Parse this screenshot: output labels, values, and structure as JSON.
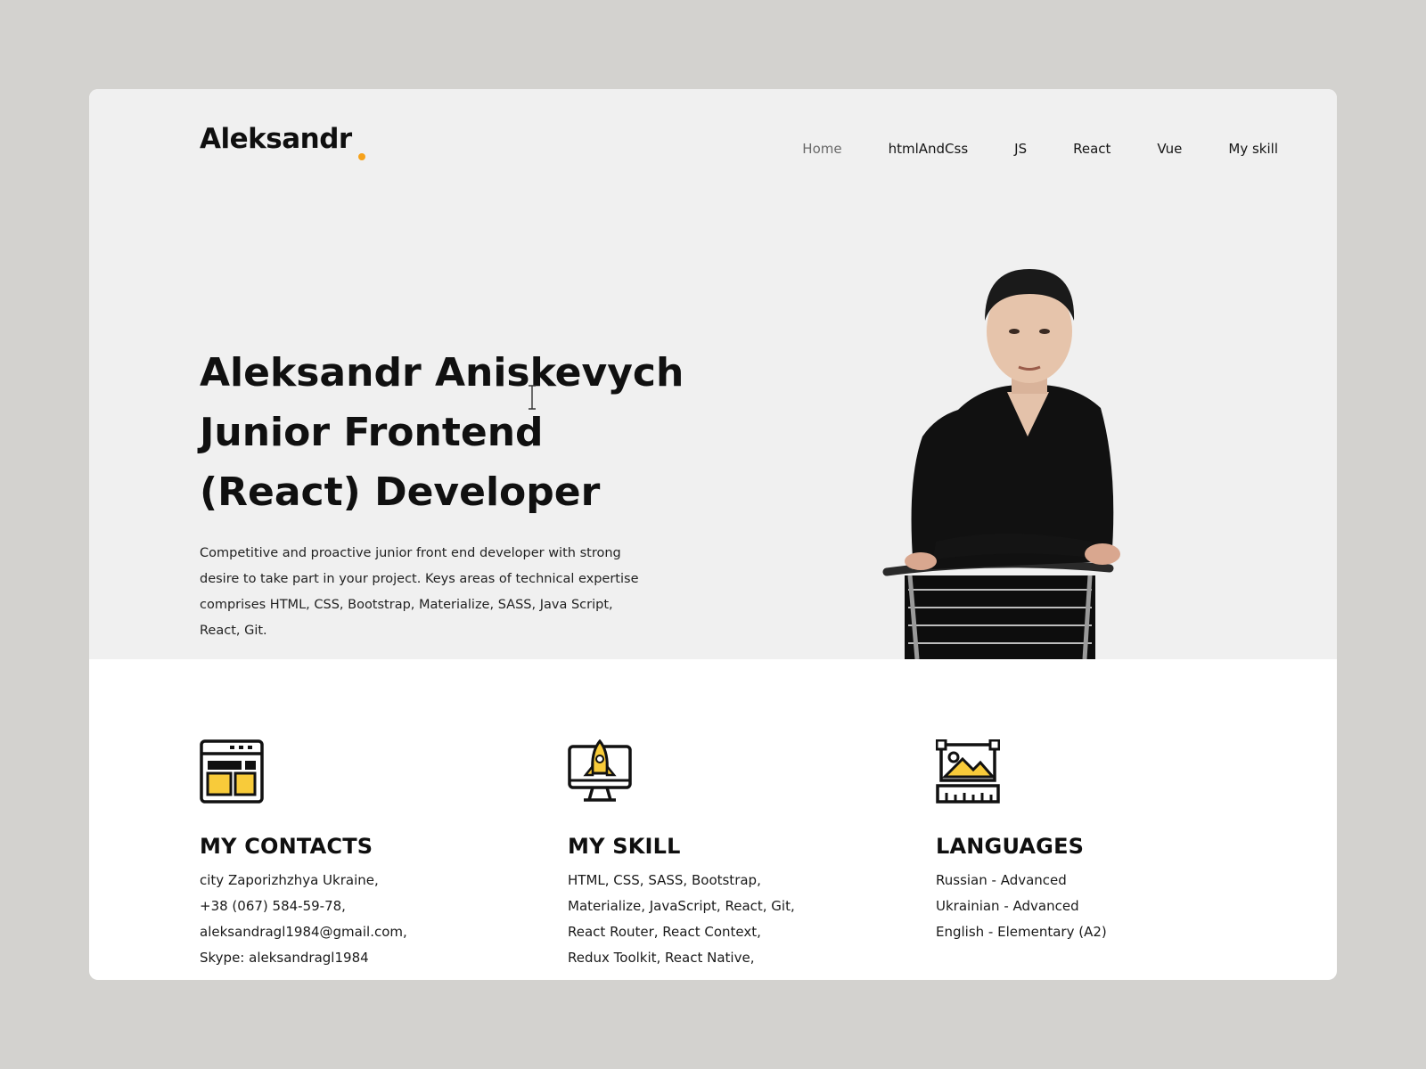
{
  "header": {
    "logo": "Aleksandr",
    "accent_color": "#f6a21b",
    "nav": [
      {
        "label": "Home",
        "active": true
      },
      {
        "label": "htmlAndCss"
      },
      {
        "label": "JS"
      },
      {
        "label": "React"
      },
      {
        "label": "Vue"
      },
      {
        "label": "My skill"
      }
    ]
  },
  "hero": {
    "title_lines": [
      "Aleksandr Aniskevych",
      "Junior Frontend",
      "(React) Developer"
    ],
    "description": "Competitive and proactive junior front end developer with strong desire to take part in your project. Keys areas of technical expertise comprises HTML, CSS, Bootstrap, Materialize, SASS, Java Script, React, Git.",
    "photo": "portrait-photo"
  },
  "sections": [
    {
      "icon": "browser-layout-icon",
      "title": "MY CONTACTS",
      "lines": [
        "city Zaporizhzhya Ukraine,",
        "+38 (067) 584-59-78,",
        "aleksandragl1984@gmail.com,",
        "Skype: aleksandragl1984"
      ]
    },
    {
      "icon": "monitor-rocket-icon",
      "title": "MY SKILL",
      "lines": [
        "HTML, CSS, SASS, Bootstrap,",
        "Materialize, JavaScript, React, Git,",
        "React Router, React Context,",
        "Redux Toolkit, React Native,"
      ]
    },
    {
      "icon": "image-ruler-icon",
      "title": "LANGUAGES",
      "lines": [
        "Russian - Advanced",
        "Ukrainian - Advanced",
        "English - Elementary (A2)"
      ]
    }
  ]
}
